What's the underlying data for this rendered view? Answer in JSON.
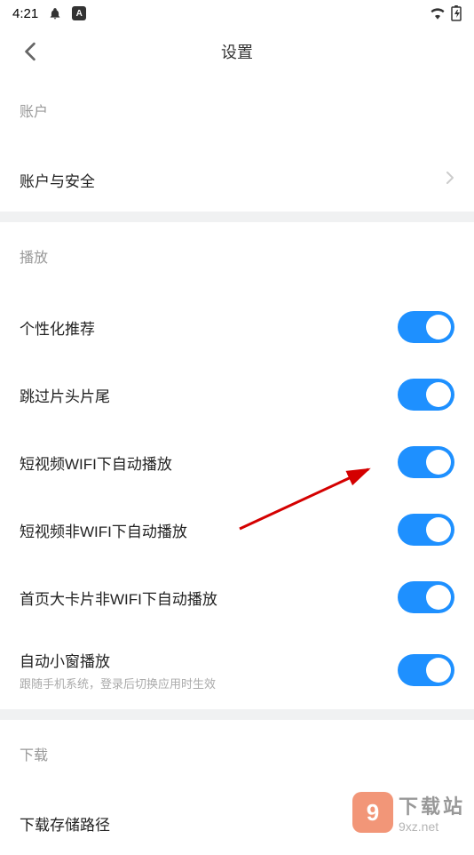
{
  "status": {
    "time": "4:21",
    "app_badge": "A"
  },
  "header": {
    "title": "设置"
  },
  "sections": {
    "account": {
      "title": "账户",
      "items": {
        "account_security": "账户与安全"
      }
    },
    "playback": {
      "title": "播放",
      "items": {
        "personalized": "个性化推荐",
        "skip_intro": "跳过片头片尾",
        "shortvideo_wifi": "短视频WIFI下自动播放",
        "shortvideo_nonwifi": "短视频非WIFI下自动播放",
        "homepage_card_nonwifi": "首页大卡片非WIFI下自动播放",
        "auto_pip": "自动小窗播放",
        "auto_pip_desc": "跟随手机系统，登录后切换应用时生效"
      }
    },
    "download": {
      "title": "下载",
      "items": {
        "storage_path": "下载存储路径"
      }
    }
  },
  "watermark": {
    "main": "下载站",
    "sub": "9xz.net",
    "icon": "9"
  }
}
